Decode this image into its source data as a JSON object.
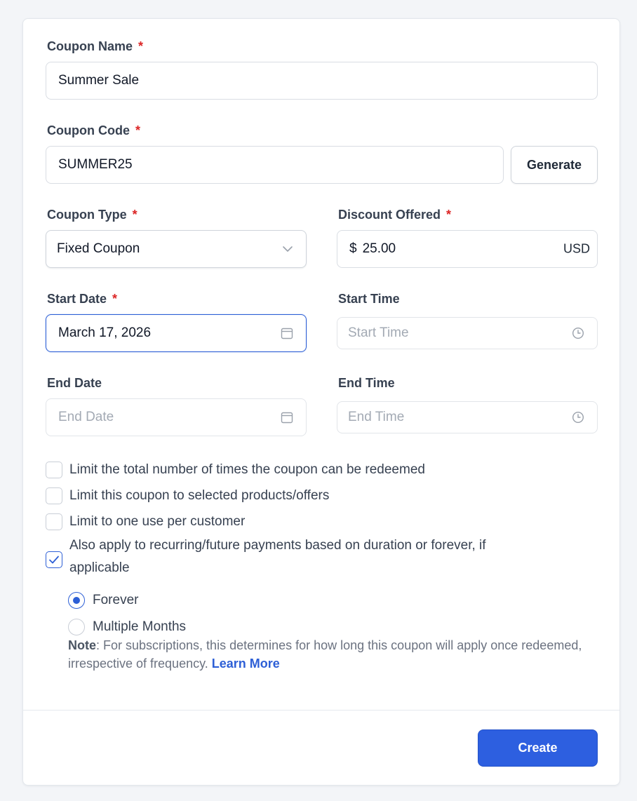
{
  "form": {
    "coupon_name": {
      "label": "Coupon Name",
      "required_mark": "*",
      "value": "Summer Sale"
    },
    "coupon_code": {
      "label": "Coupon Code",
      "required_mark": "*",
      "value": "SUMMER25",
      "generate_label": "Generate"
    },
    "coupon_type": {
      "label": "Coupon Type",
      "required_mark": "*",
      "value": "Fixed Coupon",
      "icon": "chevron-down-icon"
    },
    "discount": {
      "label": "Discount Offered",
      "required_mark": "*",
      "prefix": "$",
      "value": "25.00",
      "suffix": "USD"
    },
    "start_date": {
      "label": "Start Date",
      "required_mark": "*",
      "value": "March 17, 2026",
      "icon": "calendar-icon"
    },
    "start_time": {
      "label": "Start Time",
      "placeholder": "Start Time",
      "icon": "clock-icon"
    },
    "end_date": {
      "label": "End Date",
      "placeholder": "End Date",
      "icon": "calendar-icon"
    },
    "end_time": {
      "label": "End Time",
      "placeholder": "End Time",
      "icon": "clock-icon"
    }
  },
  "options": [
    {
      "label": "Limit the total number of times the coupon can be redeemed",
      "checked": false
    },
    {
      "label": "Limit this coupon to selected products/offers",
      "checked": false
    },
    {
      "label": "Limit to one use per customer",
      "checked": false
    },
    {
      "label": "Also apply to recurring/future payments based on duration or forever, if applicable",
      "checked": true
    }
  ],
  "duration": [
    {
      "label": "Forever",
      "selected": true
    },
    {
      "label": "Multiple Months",
      "selected": false
    }
  ],
  "note": {
    "title": "Note",
    "text": ": For subscriptions, this determines for how long this coupon will apply once redeemed, irrespective of frequency. ",
    "link": "Learn More"
  },
  "footer": {
    "create_label": "Create"
  },
  "colors": {
    "accent": "#2d5fe0",
    "required": "#dc2626",
    "page_bg": "#f3f5f8"
  }
}
